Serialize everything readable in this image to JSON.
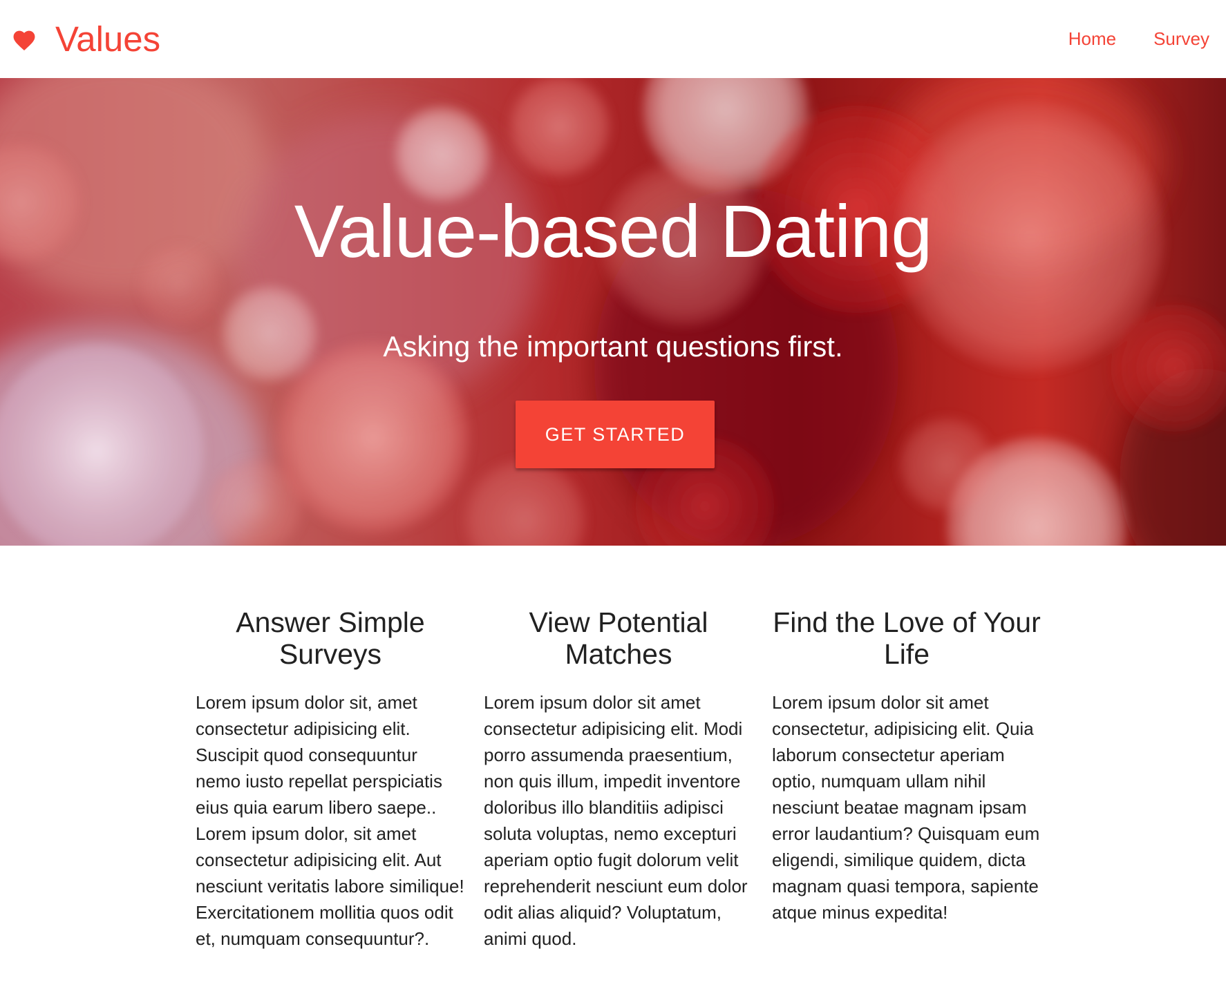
{
  "navbar": {
    "brand_icon": "heart-icon",
    "brand_text": "Values",
    "links": [
      {
        "label": "Home"
      },
      {
        "label": "Survey"
      }
    ]
  },
  "hero": {
    "title": "Value-based Dating",
    "subtitle": "Asking the important questions first.",
    "cta_label": "GET STARTED"
  },
  "features": [
    {
      "title": "Answer Simple Surveys",
      "body": "Lorem ipsum dolor sit, amet consectetur adipisicing elit. Suscipit quod consequuntur nemo iusto repellat perspiciatis eius quia earum libero saepe.. Lorem ipsum dolor, sit amet consectetur adipisicing elit. Aut nesciunt veritatis labore similique! Exercitationem mollitia quos odit et, numquam consequuntur?."
    },
    {
      "title": "View Potential Matches",
      "body": "Lorem ipsum dolor sit amet consectetur adipisicing elit. Modi porro assumenda praesentium, non quis illum, impedit inventore doloribus illo blanditiis adipisci soluta voluptas, nemo excepturi aperiam optio fugit dolorum velit reprehenderit nesciunt eum dolor odit alias aliquid? Voluptatum, animi quod."
    },
    {
      "title": "Find the Love of Your Life",
      "body": "Lorem ipsum dolor sit amet consectetur, adipisicing elit. Quia laborum consectetur aperiam optio, numquam ullam nihil nesciunt beatae magnam ipsam error laudantium? Quisquam eum eligendi, similique quidem, dicta magnam quasi tempora, sapiente atque minus expedita!"
    }
  ],
  "colors": {
    "accent": "#f44336",
    "text": "#212121",
    "hero_base": "#c9302c"
  }
}
